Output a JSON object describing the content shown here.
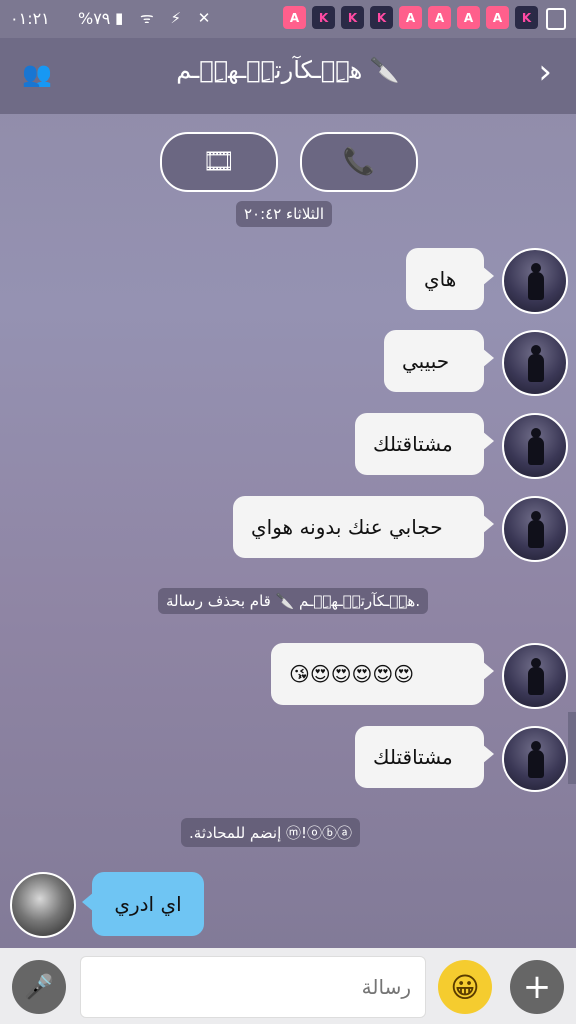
{
  "status_bar": {
    "time": "٠١:٢١",
    "battery": "%٧٩",
    "app_icons": [
      "A",
      "K",
      "K",
      "K",
      "A",
      "A",
      "A",
      "A",
      "K"
    ]
  },
  "header": {
    "title": "هِۣۗـكآرتِۣۗـهِۣۗـم 🔪"
  },
  "date_separator": "الثلاثاء ٢٠:٤٢",
  "messages": [
    {
      "text": "هاي"
    },
    {
      "text": "حبيبي"
    },
    {
      "text": "مشتاقتلك"
    },
    {
      "text": "حجابي عنك بدونه هواي"
    },
    {
      "text": "😍😍😍😍😍😘"
    },
    {
      "text": "مشتاقتلك"
    }
  ],
  "system_messages": {
    "deleted": "هِۣۗـكآرتِۣۗـهِۣۗـم 🔪 قام بحذف رسالة.",
    "joined": ".إنضم للمحادثة ⓜ!ⓞⓑⓐ"
  },
  "my_message": "اي ادري",
  "input": {
    "placeholder": "رسالة"
  },
  "icons": {
    "video": "video-icon",
    "call": "phone-video-icon",
    "group": "group-icon",
    "back": "chevron-right-icon",
    "mic": "microphone-icon",
    "emoji": "smiley-icon",
    "plus": "plus-icon"
  }
}
